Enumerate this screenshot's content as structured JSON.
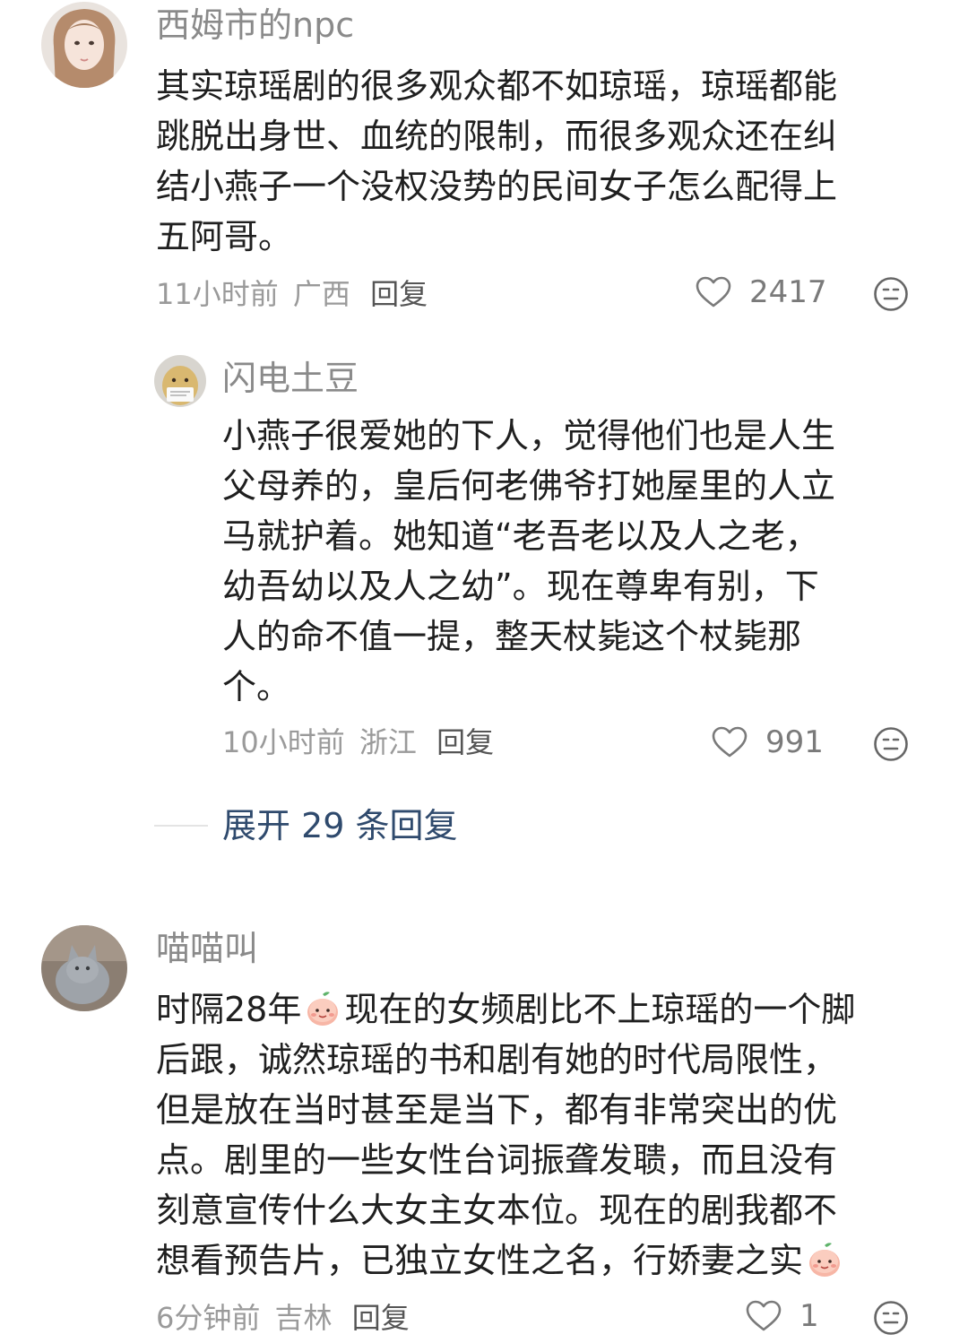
{
  "comments": [
    {
      "username": "西姆市的npc",
      "lines": [
        "其实琼瑶剧的很多观众都不如琼瑶，琼瑶都能",
        "跳脱出身世、血统的限制，而很多观众还在纠",
        "结小燕子一个没权没势的民间女子怎么配得上",
        "五阿哥。"
      ],
      "time": "11小时前",
      "location": "广西",
      "reply_label": "回复",
      "likes": "2417"
    },
    {
      "username": "闪电土豆",
      "lines": [
        "小燕子很爱她的下人，觉得他们也是人生",
        "父母养的，皇后何老佛爷打她屋里的人立",
        "马就护着。她知道“老吾老以及人之老，",
        "幼吾幼以及人之幼”。现在尊卑有别，下",
        "人的命不值一提，整天杖毙这个杖毙那",
        "个。"
      ],
      "time": "10小时前",
      "location": "浙江",
      "reply_label": "回复",
      "likes": "991"
    },
    {
      "username": "喵喵叫",
      "line1_before": "时隔28年",
      "line1_after": "现在的女频剧比不上琼瑶的一个脚",
      "lines": [
        "后跟，诚然琼瑶的书和剧有她的时代局限性，",
        "但是放在当时甚至是当下，都有非常突出的优",
        "点。剧里的一些女性台词振聋发聩，而且没有",
        "刻意宣传什么大女主女本位。现在的剧我都不"
      ],
      "last_line": "想看预告片，已独立女性之名，行娇妻之实",
      "time": "6分钟前",
      "location": "吉林",
      "reply_label": "回复",
      "likes": "1"
    }
  ],
  "expand_replies": "展开 29 条回复",
  "icons": {
    "like": "heart-outline-icon",
    "react": "neutral-face-icon",
    "inline_emoji": "peach-face-emoji"
  },
  "colors": {
    "username": "#8a8a8a",
    "link": "#2f4a6d",
    "meta": "#9a9a9a"
  }
}
